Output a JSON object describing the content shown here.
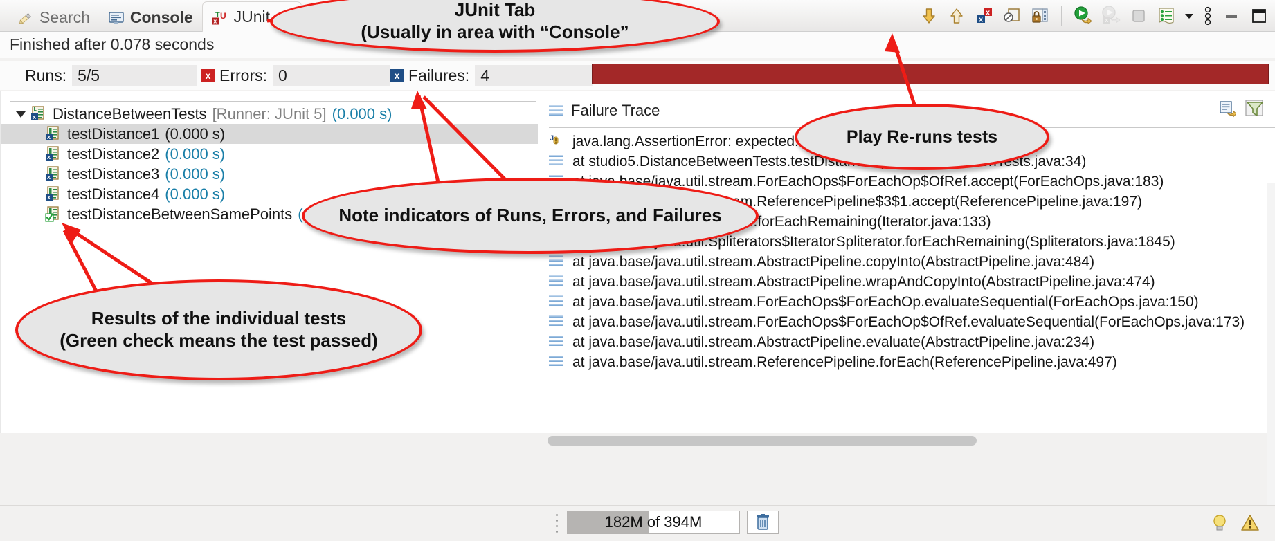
{
  "tabs": [
    {
      "label": "Search",
      "icon": "pencil-icon",
      "active": false,
      "bold": false
    },
    {
      "label": "Console",
      "icon": "console-icon",
      "active": false,
      "bold": true
    },
    {
      "label": "JUnit",
      "icon": "junit-icon",
      "active": true,
      "bold": false
    }
  ],
  "tab_close_label": "✕",
  "toolbar": {
    "items": [
      {
        "name": "next-failure-button",
        "icon": "down-arrow-icon"
      },
      {
        "name": "previous-failure-button",
        "icon": "up-arrow-icon"
      },
      {
        "name": "show-failures-only-button",
        "icon": "failures-only-icon"
      },
      {
        "name": "stop-on-error-button",
        "icon": "no-entry-page-icon"
      },
      {
        "name": "lock-history-button",
        "icon": "lock-page-icon"
      },
      {
        "name": "rerun-test-button",
        "icon": "green-play-icon"
      },
      {
        "name": "rerun-failed-tests-button",
        "icon": "rerun-failed-icon"
      },
      {
        "name": "stop-button",
        "icon": "stop-square-icon"
      },
      {
        "name": "view-menu-button",
        "icon": "list-menu-icon"
      },
      {
        "name": "view-menu-dropdown",
        "icon": "chevron-down-icon"
      },
      {
        "name": "view-overflow-menu-button",
        "icon": "kebab-menu-icon"
      },
      {
        "name": "minimize-button",
        "icon": "minimize-icon"
      },
      {
        "name": "maximize-button",
        "icon": "maximize-icon"
      }
    ]
  },
  "status": {
    "finished_text": "Finished after 0.078 seconds"
  },
  "counters": {
    "runs_label": "Runs:",
    "runs_value": "5/5",
    "errors_label": "Errors:",
    "errors_value": "0",
    "failures_label": "Failures:",
    "failures_value": "4",
    "progress_color": "#a32828"
  },
  "tree": {
    "root": {
      "name": "DistanceBetweenTests",
      "runner": "[Runner: JUnit 5]",
      "time": "(0.000 s)",
      "icon": "test-failed-class-icon"
    },
    "items": [
      {
        "name": "testDistance1",
        "time": "(0.000 s)",
        "status": "failed",
        "selected": true,
        "icon": "test-failed-icon"
      },
      {
        "name": "testDistance2",
        "time": "(0.000 s)",
        "status": "failed",
        "selected": false,
        "icon": "test-failed-icon"
      },
      {
        "name": "testDistance3",
        "time": "(0.000 s)",
        "status": "failed",
        "selected": false,
        "icon": "test-failed-icon"
      },
      {
        "name": "testDistance4",
        "time": "(0.000 s)",
        "status": "failed",
        "selected": false,
        "icon": "test-failed-icon"
      },
      {
        "name": "testDistanceBetweenSamePoints",
        "time": "(0.000 s)",
        "status": "passed",
        "selected": false,
        "icon": "test-passed-icon"
      }
    ]
  },
  "failure_trace": {
    "title": "Failure Trace",
    "tools": [
      {
        "name": "copy-trace-button",
        "icon": "copy-icon"
      },
      {
        "name": "filter-stack-trace-button",
        "icon": "filter-icon"
      }
    ],
    "lines": [
      {
        "icon": "assertion-error-icon",
        "text": "java.lang.AssertionError: expected:<"
      },
      {
        "icon": "stack-frame-icon",
        "text": "at studio5.DistanceBetweenTests.testDistance1(DistanceBetweenTests.java:34)"
      },
      {
        "icon": "stack-frame-icon",
        "text": "at java.base/java.util.stream.ForEachOps$ForEachOp$OfRef.accept(ForEachOps.java:183)"
      },
      {
        "icon": "stack-frame-icon",
        "text": "at java.base/java.util.stream.ReferencePipeline$3$1.accept(ReferencePipeline.java:197)"
      },
      {
        "icon": "stack-frame-icon",
        "text": "at java.base/java.util.Iterator.forEachRemaining(Iterator.java:133)"
      },
      {
        "icon": "stack-frame-icon",
        "text": "at java.base/java.util.Spliterators$IteratorSpliterator.forEachRemaining(Spliterators.java:1845)"
      },
      {
        "icon": "stack-frame-icon",
        "text": "at java.base/java.util.stream.AbstractPipeline.copyInto(AbstractPipeline.java:484)"
      },
      {
        "icon": "stack-frame-icon",
        "text": "at java.base/java.util.stream.AbstractPipeline.wrapAndCopyInto(AbstractPipeline.java:474)"
      },
      {
        "icon": "stack-frame-icon",
        "text": "at java.base/java.util.stream.ForEachOps$ForEachOp.evaluateSequential(ForEachOps.java:150)"
      },
      {
        "icon": "stack-frame-icon",
        "text": "at java.base/java.util.stream.ForEachOps$ForEachOp$OfRef.evaluateSequential(ForEachOps.java:173)"
      },
      {
        "icon": "stack-frame-icon",
        "text": "at java.base/java.util.stream.AbstractPipeline.evaluate(AbstractPipeline.java:234)"
      },
      {
        "icon": "stack-frame-icon",
        "text": "at java.base/java.util.stream.ReferencePipeline.forEach(ReferencePipeline.java:497)"
      }
    ]
  },
  "bottom": {
    "memory_text": "182M of 394M",
    "memory_used": "182M",
    "memory_total": "394M",
    "trash_icon": "trash-icon",
    "tip_icon": "lightbulb-icon",
    "warning_icon": "warning-icon"
  },
  "annotations": {
    "accent_color": "#ee1c16",
    "bubbles": [
      {
        "id": "junit-tab-note",
        "lines": [
          "JUnit Tab",
          "(Usually in area with “Console”"
        ]
      },
      {
        "id": "play-rerun-note",
        "lines": [
          "Play Re-runs tests"
        ]
      },
      {
        "id": "indicators-note",
        "lines": [
          "Note indicators of Runs, Errors, and Failures"
        ]
      },
      {
        "id": "individual-results-note",
        "lines": [
          "Results of the individual tests",
          "(Green check means the test passed)"
        ]
      }
    ]
  }
}
